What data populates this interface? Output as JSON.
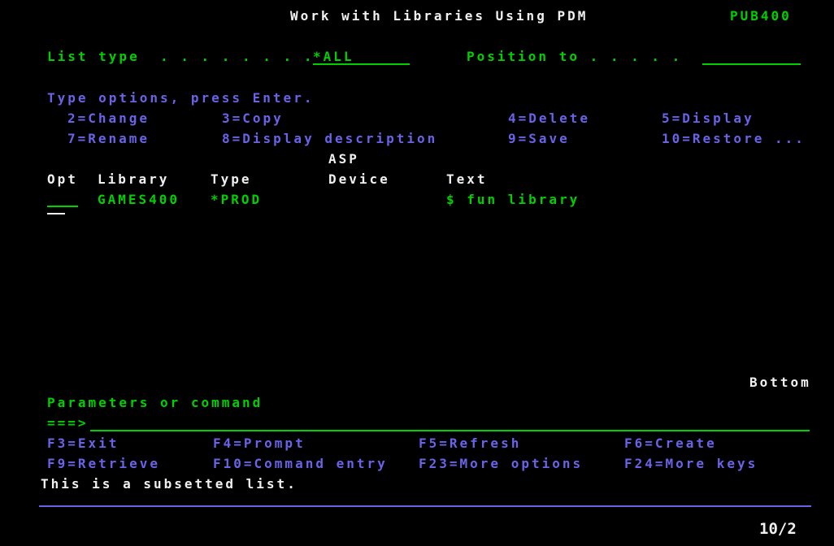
{
  "screen": {
    "title": "Work with Libraries Using PDM",
    "system_name": "PUB400",
    "colors": {
      "background": "#000000",
      "green": "#00D000",
      "white": "#F0F0F0",
      "blue": "#6A63E8"
    }
  },
  "filter": {
    "list_type_label": "List type  . . . . . . . .",
    "list_type_value": "*ALL",
    "position_to_label": "Position to . . . . .",
    "position_to_value": ""
  },
  "instruction": "Type options, press Enter.",
  "options": [
    {
      "label": "2=Change"
    },
    {
      "label": "3=Copy"
    },
    {
      "label": "4=Delete"
    },
    {
      "label": "5=Display"
    },
    {
      "label": "7=Rename"
    },
    {
      "label": "8=Display description"
    },
    {
      "label": "9=Save"
    },
    {
      "label": "10=Restore ..."
    }
  ],
  "list": {
    "asp_header": "ASP",
    "columns": [
      {
        "label": "Opt"
      },
      {
        "label": "Library"
      },
      {
        "label": "Type"
      },
      {
        "label": "Device"
      },
      {
        "label": "Text"
      }
    ],
    "rows": [
      {
        "opt": "",
        "library": "GAMES400",
        "type": "*PROD",
        "device": "",
        "text": "$ fun library"
      }
    ],
    "more_indicator": "Bottom"
  },
  "command": {
    "label": "Parameters or command",
    "prompt": "===>",
    "value": ""
  },
  "function_keys": [
    {
      "label": "F3=Exit"
    },
    {
      "label": "F4=Prompt"
    },
    {
      "label": "F5=Refresh"
    },
    {
      "label": "F6=Create"
    },
    {
      "label": "F9=Retrieve"
    },
    {
      "label": "F10=Command entry"
    },
    {
      "label": "F23=More options"
    },
    {
      "label": "F24=More keys"
    }
  ],
  "message": "This is a subsetted list.",
  "status": {
    "cursor_position": "10/2"
  }
}
